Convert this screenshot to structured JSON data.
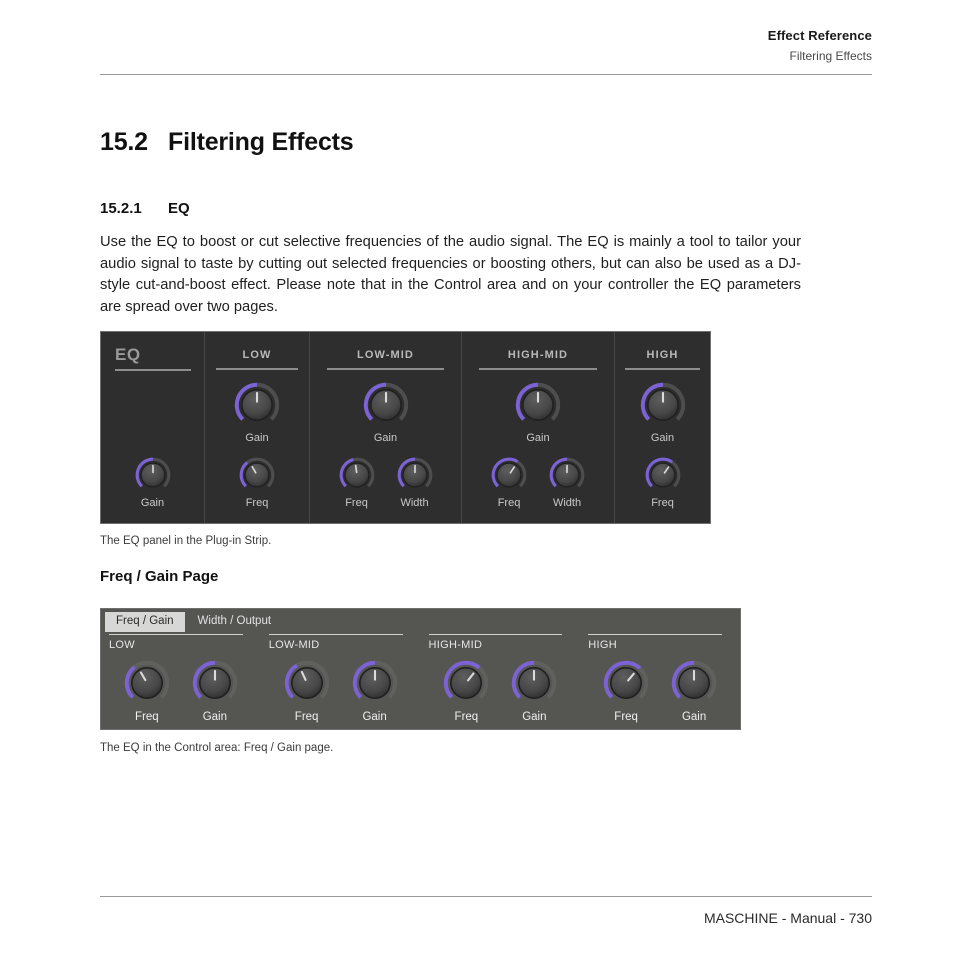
{
  "runhead": {
    "title": "Effect Reference",
    "subtitle": "Filtering Effects"
  },
  "headings": {
    "section_number": "15.2",
    "section_title": "Filtering Effects",
    "subsection_number": "15.2.1",
    "subsection_title": "EQ",
    "page_heading": "Freq / Gain Page"
  },
  "body": {
    "paragraph": "Use the EQ to boost or cut selective frequencies of the audio signal. The EQ is mainly a tool to tailor your audio signal to taste by cutting out selected frequencies or boosting others, but can also be used as a DJ-style cut-and-boost effect. Please note that in the Control area and on your controller the EQ parameters are spread over two pages."
  },
  "captions": {
    "figure1": "The EQ panel in the Plug-in Strip.",
    "figure2": "The EQ in the Control area: Freq / Gain page."
  },
  "plugin_strip": {
    "columns": [
      {
        "header": "EQ",
        "top_knobs": [],
        "bottom_knobs": [
          {
            "label": "Gain",
            "angle": 0,
            "arc": 50
          }
        ]
      },
      {
        "header": "LOW",
        "top_knobs": [
          {
            "label": "Gain",
            "angle": 0,
            "arc": 50
          }
        ],
        "bottom_knobs": [
          {
            "label": "Freq",
            "angle": -30,
            "arc": 36
          }
        ]
      },
      {
        "header": "LOW-MID",
        "top_knobs": [
          {
            "label": "Gain",
            "angle": 0,
            "arc": 50
          }
        ],
        "bottom_knobs": [
          {
            "label": "Freq",
            "angle": -8,
            "arc": 45
          },
          {
            "label": "Width",
            "angle": 0,
            "arc": 50
          }
        ]
      },
      {
        "header": "HIGH-MID",
        "top_knobs": [
          {
            "label": "Gain",
            "angle": 0,
            "arc": 50
          }
        ],
        "bottom_knobs": [
          {
            "label": "Freq",
            "angle": 33,
            "arc": 62
          },
          {
            "label": "Width",
            "angle": 0,
            "arc": 50
          }
        ]
      },
      {
        "header": "HIGH",
        "top_knobs": [
          {
            "label": "Gain",
            "angle": 0,
            "arc": 50
          }
        ],
        "bottom_knobs": [
          {
            "label": "Freq",
            "angle": 35,
            "arc": 63
          }
        ]
      }
    ]
  },
  "control_area": {
    "tabs": [
      {
        "label": "Freq / Gain",
        "active": true
      },
      {
        "label": "Width / Output",
        "active": false
      }
    ],
    "sections": [
      {
        "header": "LOW",
        "knobs": [
          {
            "label": "Freq",
            "angle": -30,
            "arc": 36
          },
          {
            "label": "Gain",
            "angle": 0,
            "arc": 50
          }
        ]
      },
      {
        "header": "LOW-MID",
        "knobs": [
          {
            "label": "Freq",
            "angle": -25,
            "arc": 39
          },
          {
            "label": "Gain",
            "angle": 0,
            "arc": 50
          }
        ]
      },
      {
        "header": "HIGH-MID",
        "knobs": [
          {
            "label": "Freq",
            "angle": 38,
            "arc": 65
          },
          {
            "label": "Gain",
            "angle": 0,
            "arc": 50
          }
        ]
      },
      {
        "header": "HIGH",
        "knobs": [
          {
            "label": "Freq",
            "angle": 40,
            "arc": 66
          },
          {
            "label": "Gain",
            "angle": 0,
            "arc": 50
          }
        ]
      }
    ]
  },
  "footer": {
    "text": "MASCHINE - Manual - 730"
  },
  "colors": {
    "accent_purple": "#7b63d6",
    "strip_background": "#2e2e2e",
    "control_background": "#555552",
    "knob_body": "#4a4a4a",
    "page_background": "#ffffff"
  }
}
